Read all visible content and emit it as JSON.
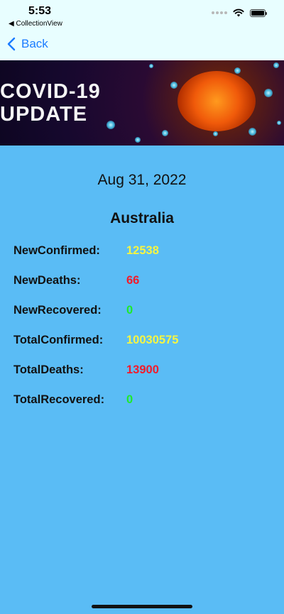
{
  "status_bar": {
    "time": "5:53",
    "back_app": "◀ CollectionView"
  },
  "nav": {
    "back_label": "Back"
  },
  "banner": {
    "title": "COVID-19\nUPDATE"
  },
  "report": {
    "date": "Aug 31, 2022",
    "country": "Australia",
    "stats": [
      {
        "label": "NewConfirmed:",
        "value": "12538",
        "color": "#F5F542"
      },
      {
        "label": "NewDeaths:",
        "value": "66",
        "color": "#F21B2B"
      },
      {
        "label": "NewRecovered:",
        "value": "0",
        "color": "#1FEA2A"
      },
      {
        "label": "TotalConfirmed:",
        "value": "10030575",
        "color": "#F5F542"
      },
      {
        "label": "TotalDeaths:",
        "value": "13900",
        "color": "#F21B2B"
      },
      {
        "label": "TotalRecovered:",
        "value": "0",
        "color": "#1FEA2A"
      }
    ]
  },
  "colors": {
    "nav_background": "#E8FEFF",
    "page_background": "#5ABCF5",
    "accent": "#1A7BFF"
  },
  "icons": {
    "back": "chevron-left-icon",
    "wifi": "wifi-icon",
    "battery": "battery-icon",
    "signal": "signal-icon"
  }
}
